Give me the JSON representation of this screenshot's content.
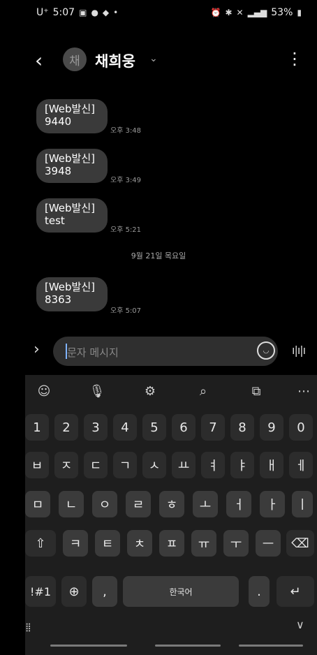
{
  "status": {
    "carrier": "U⁺",
    "time": "5:07",
    "battery": "53%"
  },
  "header": {
    "avatar_initial": "채",
    "contact_name": "채희웅"
  },
  "messages": [
    {
      "line1": "[Web발신]",
      "line2": "9440",
      "time": "오후 3:48"
    },
    {
      "line1": "[Web발신]",
      "line2": "3948",
      "time": "오후 3:49"
    },
    {
      "line1": "[Web발신]",
      "line2": "test",
      "time": "오후 5:21"
    },
    {
      "line1": "[Web발신]",
      "line2": "8363",
      "time": "오후 5:07"
    }
  ],
  "date_separator": "9월 21일 목요일",
  "compose": {
    "placeholder": "문자 메시지"
  },
  "keyboard": {
    "number_row": [
      "1",
      "2",
      "3",
      "4",
      "5",
      "6",
      "7",
      "8",
      "9",
      "0"
    ],
    "row1": [
      "ㅂ",
      "ㅈ",
      "ㄷ",
      "ㄱ",
      "ㅅ",
      "ㅛ",
      "ㅕ",
      "ㅑ",
      "ㅐ",
      "ㅔ"
    ],
    "row2": [
      "ㅁ",
      "ㄴ",
      "ㅇ",
      "ㄹ",
      "ㅎ",
      "ㅗ",
      "ㅓ",
      "ㅏ",
      "ㅣ"
    ],
    "row3": [
      "ㅋ",
      "ㅌ",
      "ㅊ",
      "ㅍ",
      "ㅠ",
      "ㅜ",
      "ㅡ"
    ],
    "symbols_label": "!#1",
    "comma": ",",
    "space_label": "한국어",
    "period": "."
  }
}
